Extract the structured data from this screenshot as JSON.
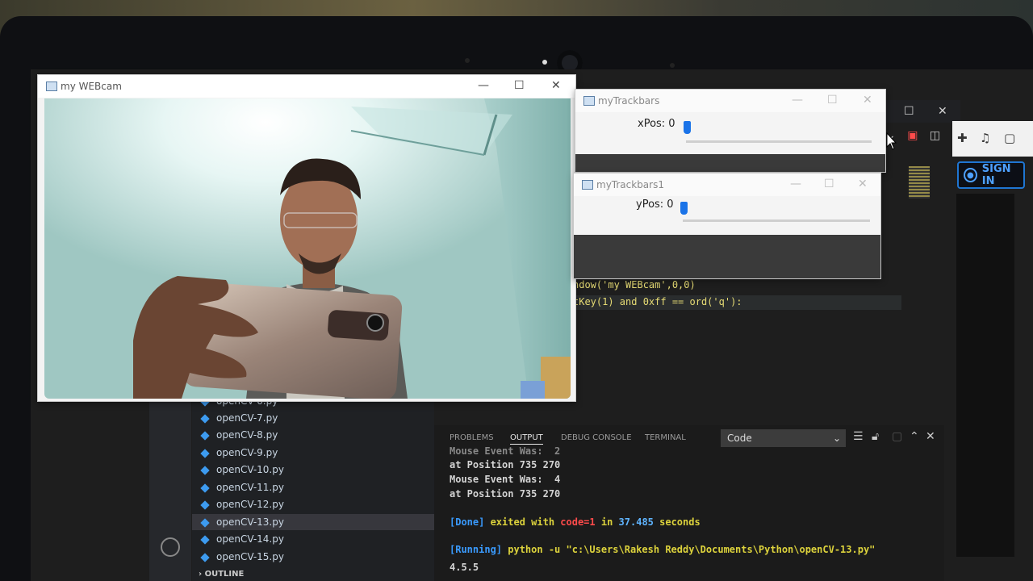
{
  "webcam_window": {
    "title": "my WEBcam",
    "controls": [
      "—",
      "☐",
      "✕"
    ]
  },
  "trackbar_windows": [
    {
      "title": "myTrackbars",
      "label": "xPos: 0",
      "value": 0
    },
    {
      "title": "myTrackbars1",
      "label": "yPos: 0",
      "value": 0
    }
  ],
  "editor": {
    "code_lines": [
      "ndow('my WEBcam',0,0)",
      "tKey(1) and 0xff == ord('q'):"
    ]
  },
  "browser": {
    "signin_label": "SIGN IN"
  },
  "explorer": {
    "files": [
      "openCV-6.py",
      "openCV-7.py",
      "openCV-8.py",
      "openCV-9.py",
      "openCV-10.py",
      "openCV-11.py",
      "openCV-12.py",
      "openCV-13.py",
      "openCV-14.py",
      "openCV-15.py"
    ],
    "active_file": "openCV-13.py",
    "outline_label": "OUTLINE"
  },
  "panel": {
    "tabs": [
      "PROBLEMS",
      "OUTPUT",
      "DEBUG CONSOLE",
      "TERMINAL"
    ],
    "active_tab": "OUTPUT",
    "output_channel": "Code",
    "lines": {
      "l1": "Mouse Event Was:  2",
      "l2": "at Position 735 270",
      "l3": "Mouse Event Was:  4",
      "l4": "at Position 735 270",
      "done_tag": "[Done]",
      "done_text": " exited with ",
      "done_code": "code=1",
      "done_in": " in ",
      "done_secs": "37.485",
      "done_unit": " seconds",
      "run_tag": "[Running]",
      "run_cmd": " python -u \"c:\\Users\\Rakesh Reddy\\Documents\\Python\\openCV-13.py\"",
      "version": "4.5.5"
    }
  },
  "colors": {
    "accent_blue": "#1a73e8",
    "signin_blue": "#1f76d2"
  }
}
